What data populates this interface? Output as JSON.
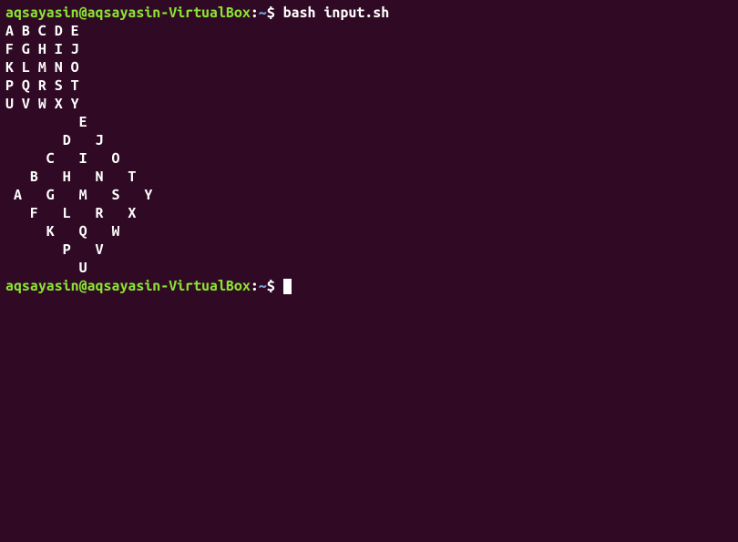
{
  "prompt1": {
    "user_host": "aqsayasin@aqsayasin-VirtualBox",
    "colon": ":",
    "path": "~",
    "dollar": "$ ",
    "command": "bash input.sh"
  },
  "output": {
    "blank1": "",
    "row1": "A B C D E",
    "row2": "F G H I J",
    "row3": "K L M N O",
    "row4": "P Q R S T",
    "row5": "U V W X Y",
    "blank2": "",
    "blank3": "",
    "blank4": "",
    "d1": "         E",
    "blank5": "",
    "d2": "       D   J",
    "blank6": "",
    "d3": "     C   I   O",
    "blank7": "",
    "d4": "   B   H   N   T",
    "blank8": "",
    "d5": " A   G   M   S   Y",
    "blank9": "",
    "d6": "   F   L   R   X",
    "blank10": "",
    "d7": "     K   Q   W",
    "blank11": "",
    "d8": "       P   V",
    "blank12": "",
    "d9": "         U",
    "blank13": ""
  },
  "prompt2": {
    "user_host": "aqsayasin@aqsayasin-VirtualBox",
    "colon": ":",
    "path": "~",
    "dollar": "$ "
  }
}
